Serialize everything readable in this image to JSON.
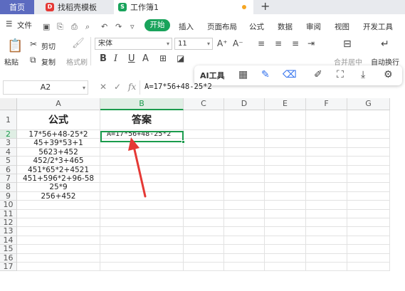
{
  "tabs": [
    {
      "label": "首页"
    },
    {
      "label": "找稻壳模板"
    },
    {
      "label": "工作簿1"
    }
  ],
  "menu": {
    "file": "文件",
    "items": [
      "开始",
      "插入",
      "页面布局",
      "公式",
      "数据",
      "审阅",
      "视图",
      "开发工具"
    ]
  },
  "ribbon": {
    "paste": "粘贴",
    "cut": "剪切",
    "copy": "复制",
    "format_painter": "格式刷",
    "font_name": "宋体",
    "font_size": "11",
    "merge_center": "合并居中",
    "wrap_text": "自动换行"
  },
  "floating_toolbar": {
    "ai_label": "AI工具"
  },
  "formula_bar": {
    "name_box": "A2",
    "formula": "A=17*56+48-25*2"
  },
  "grid": {
    "columns": [
      "A",
      "B",
      "C",
      "D",
      "E",
      "F",
      "G"
    ],
    "rows": [
      "1",
      "2",
      "3",
      "4",
      "5",
      "6",
      "7",
      "8",
      "9",
      "10",
      "11",
      "12",
      "13",
      "14",
      "15",
      "16",
      "17"
    ],
    "header_a": "公式",
    "header_b": "答案",
    "column_a": [
      "17*56+48-25*2",
      "45+39*53+1",
      "5623+452",
      "452/2*3+465",
      "451*65*2+4521",
      "451+596*2+96-58",
      "25*9",
      "256+452"
    ],
    "b2": "A=17*56+48-25*2"
  },
  "colors": {
    "accent_green": "#1a9b4c",
    "start_button": "#19a35b",
    "home_tab": "#5c6bc0",
    "arrow": "#e53935"
  }
}
